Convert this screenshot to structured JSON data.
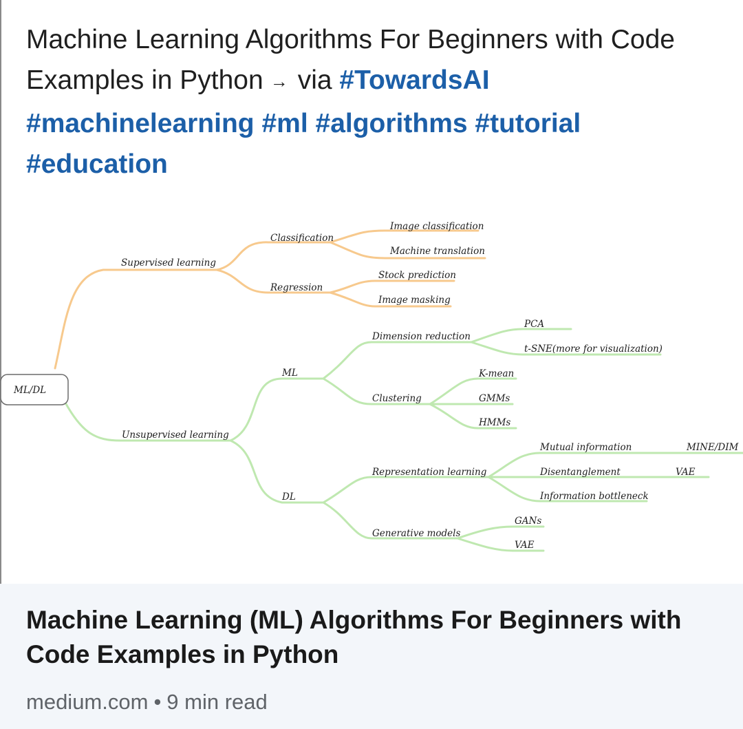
{
  "post": {
    "title_part1": "Machine Learning Algorithms For Beginners with Code Examples in Python",
    "arrow": "→",
    "via": "via",
    "hashtags": [
      "#TowardsAI",
      "#machinelearning",
      "#ml",
      "#algorithms",
      "#tutorial",
      "#education"
    ]
  },
  "mindmap": {
    "root": "ML/DL",
    "supervised": "Supervised learning",
    "classification": "Classification",
    "image_classification": "Image classification",
    "machine_translation": "Machine translation",
    "regression": "Regression",
    "stock_prediction": "Stock prediction",
    "image_masking": "Image masking",
    "unsupervised": "Unsupervised learning",
    "ml": "ML",
    "dimension_reduction": "Dimension reduction",
    "pca": "PCA",
    "tsne": "t-SNE(more for visualization)",
    "clustering": "Clustering",
    "kmean": "K-mean",
    "gmms": "GMMs",
    "hmms": "HMMs",
    "dl": "DL",
    "representation_learning": "Representation learning",
    "mutual_information": "Mutual information",
    "mine_dim": "MINE/DIM",
    "disentanglement": "Disentanglement",
    "vae_1": "VAE",
    "information_bottleneck": "Information bottleneck",
    "generative_models": "Generative models",
    "gans": "GANs",
    "vae_2": "VAE",
    "colors": {
      "supervised_branch": "#f7c98d",
      "unsupervised_branch": "#bfe8b0"
    }
  },
  "card": {
    "title": "Machine Learning (ML) Algorithms For Beginners with Code Examples in Python",
    "source": "medium.com",
    "separator": "•",
    "read_time": "9 min read"
  }
}
